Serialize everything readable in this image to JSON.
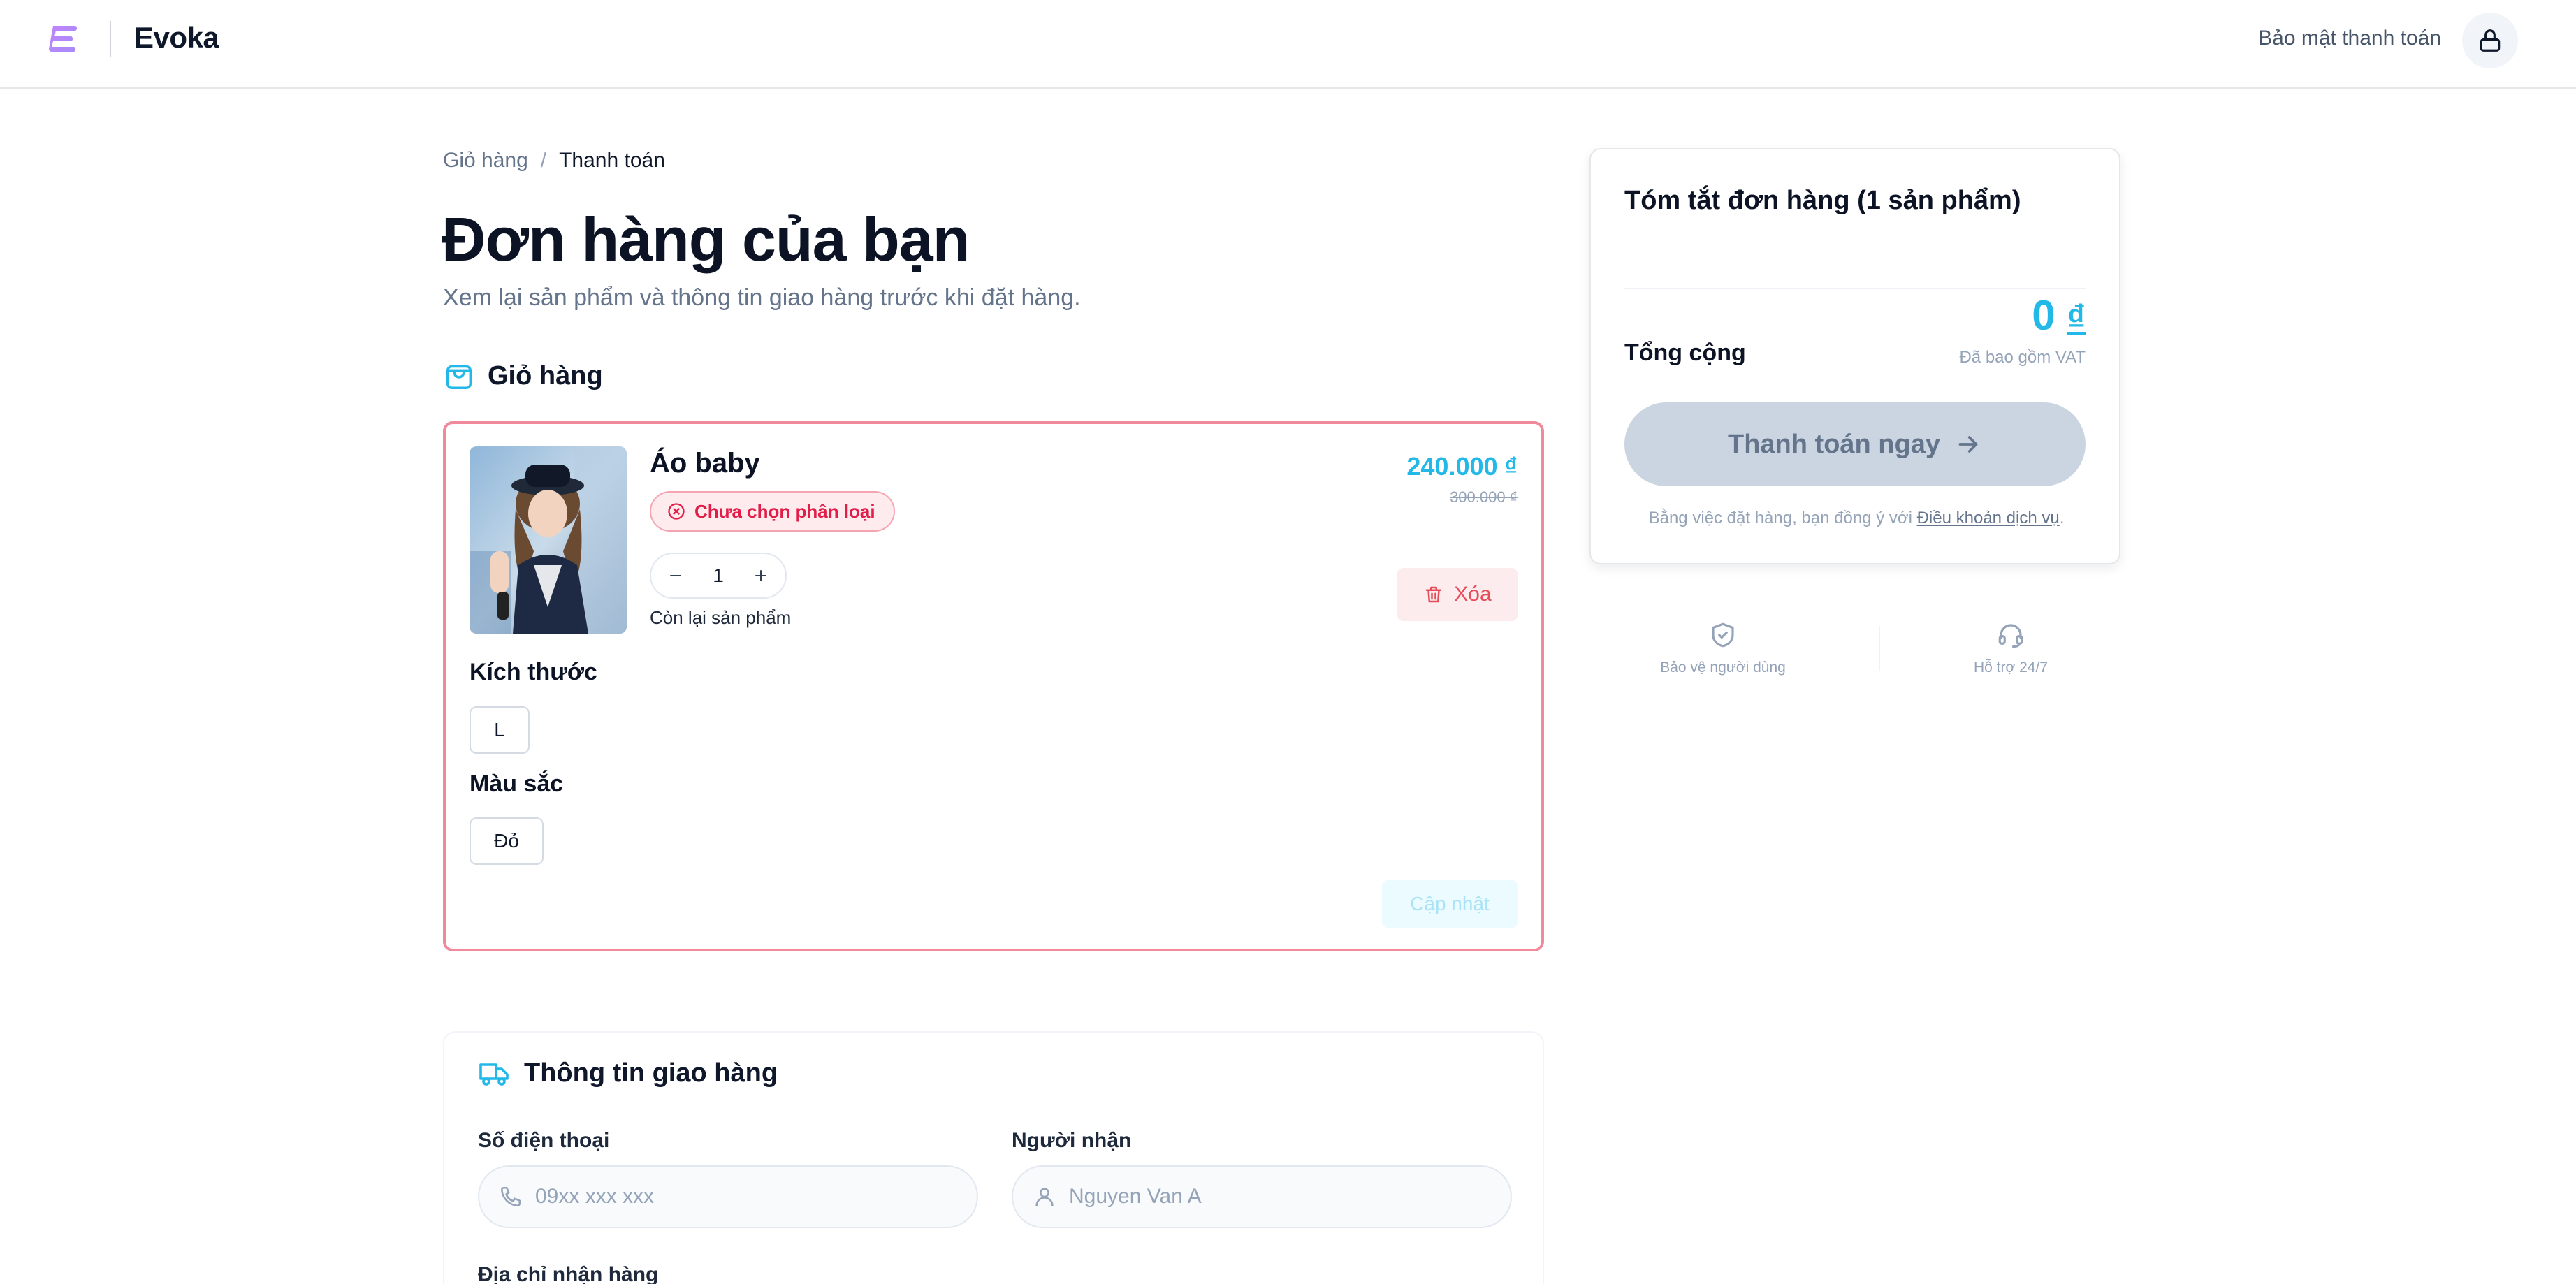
{
  "header": {
    "brand": "Evoka",
    "security_text": "Bảo mật thanh toán",
    "logo_icon": "evoka-logo-icon",
    "lock_icon": "lock-icon"
  },
  "breadcrumb": {
    "items": [
      "Giỏ hàng",
      "Thanh toán"
    ],
    "separator": "/"
  },
  "page": {
    "title": "Đơn hàng của bạn",
    "subtitle": "Xem lại sản phẩm và thông tin giao hàng trước khi đặt hàng."
  },
  "cart": {
    "section_title": "Giỏ hàng",
    "item": {
      "name": "Áo baby",
      "variant_warning": "Chưa chọn phân loại",
      "quantity": "1",
      "stock_note": "Còn lại sản phẩm",
      "price": "240.000 ₫",
      "old_price": "300.000 ₫",
      "delete_label": "Xóa",
      "size_label": "Kích thước",
      "size_value": "L",
      "color_label": "Màu sắc",
      "color_value": "Đỏ",
      "update_label": "Cập nhật"
    }
  },
  "shipping": {
    "section_title": "Thông tin giao hàng",
    "phone_label": "Số điện thoại",
    "phone_placeholder": "09xx xxx xxx",
    "recipient_label": "Người nhận",
    "recipient_placeholder": "Nguyen Van A",
    "address_label": "Địa chỉ nhận hàng"
  },
  "summary": {
    "title": "Tóm tắt đơn hàng (1 sản phẩm)",
    "total_label": "Tổng cộng",
    "total_amount": "0",
    "currency": "₫",
    "vat_note": "Đã bao gồm VAT",
    "pay_button": "Thanh toán ngay",
    "terms_prefix": "Bằng việc đặt hàng, bạn đồng ý với ",
    "terms_link": "Điều khoản dịch vụ",
    "terms_suffix": "."
  },
  "badges": [
    {
      "label": "Bảo vệ người dùng",
      "icon": "shield-check-icon"
    },
    {
      "label": "Hỗ trợ 24/7",
      "icon": "headset-icon"
    }
  ],
  "colors": {
    "accent": "#22b8e8",
    "danger": "#e11d48",
    "error_border": "#f08a9a",
    "disabled_button": "#cbd5e1"
  }
}
